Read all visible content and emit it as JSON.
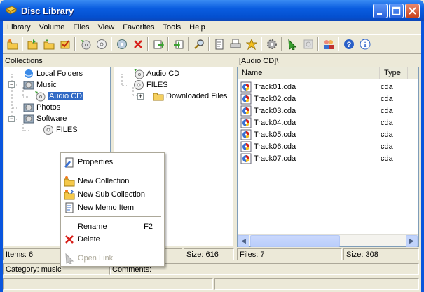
{
  "window": {
    "title": "Disc Library"
  },
  "menu": [
    "Library",
    "Volume",
    "Files",
    "View",
    "Favorites",
    "Tools",
    "Help"
  ],
  "collections": {
    "header": "Collections",
    "nodes": [
      "Local Folders",
      "Music",
      "Audio CD",
      "Photos",
      "Software",
      "FILES"
    ]
  },
  "disc_tree": {
    "nodes": [
      "Audio CD",
      "FILES",
      "Downloaded Files"
    ]
  },
  "file_list": {
    "path": "[Audio CD]\\",
    "columns": [
      "Name",
      "Type"
    ],
    "rows": [
      {
        "name": "Track01.cda",
        "type": "cda"
      },
      {
        "name": "Track02.cda",
        "type": "cda"
      },
      {
        "name": "Track03.cda",
        "type": "cda"
      },
      {
        "name": "Track04.cda",
        "type": "cda"
      },
      {
        "name": "Track05.cda",
        "type": "cda"
      },
      {
        "name": "Track06.cda",
        "type": "cda"
      },
      {
        "name": "Track07.cda",
        "type": "cda"
      }
    ]
  },
  "context_menu": {
    "properties": "Properties",
    "new_collection": "New Collection",
    "new_sub_collection": "New Sub Collection",
    "new_memo_item": "New Memo Item",
    "rename": "Rename",
    "rename_shortcut": "F2",
    "delete": "Delete",
    "open_link": "Open Link"
  },
  "status": {
    "items": "Items: 6",
    "size_left": "Size: 616",
    "files": "Files: 7",
    "size_right": "Size: 308",
    "category": "Category: music",
    "comments": "Comments:"
  },
  "colors": {
    "titlebar": "#0a5de0",
    "selection": "#316ac5",
    "menu_bg": "#ece9d8"
  }
}
